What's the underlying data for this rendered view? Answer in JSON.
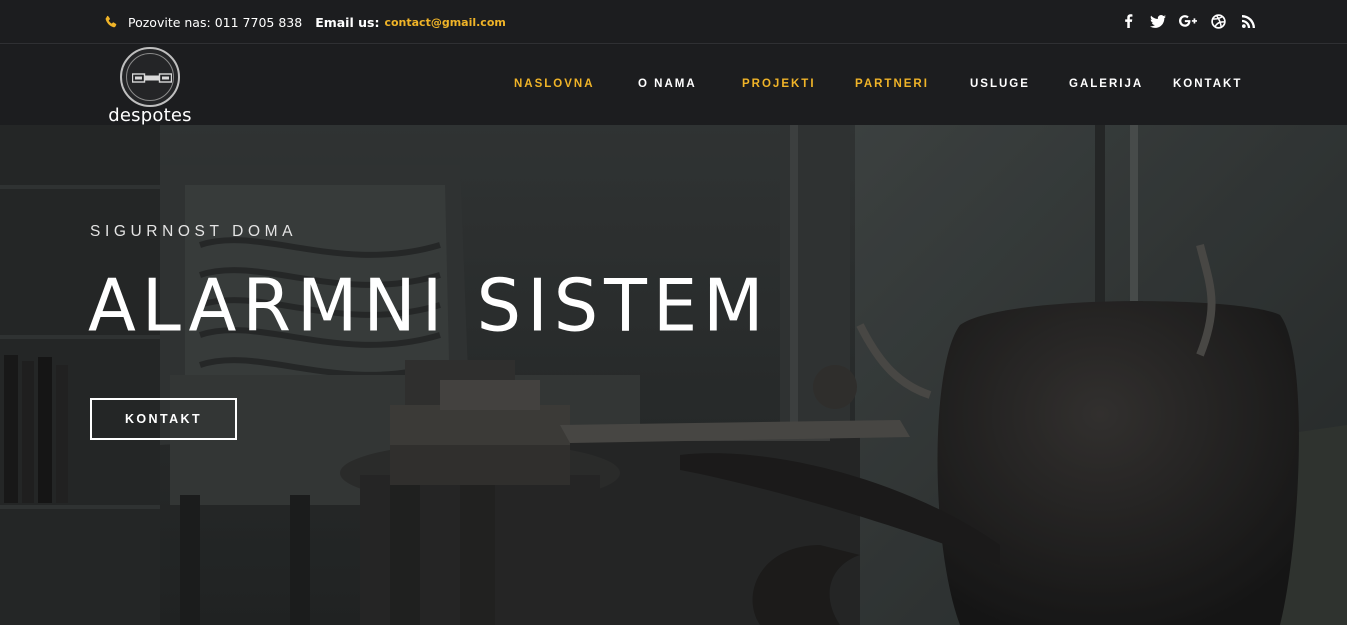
{
  "topbar": {
    "phone_label": "Pozovite nas:",
    "phone_number": "011 7705 838",
    "email_label": "Email us:",
    "email_value": "contact@gmail.com",
    "accent_color": "#f0b428",
    "socials": [
      "facebook-icon",
      "twitter-icon",
      "google-plus-icon",
      "dribbble-icon",
      "rss-icon"
    ]
  },
  "header": {
    "logo_text": "despotes",
    "nav": [
      {
        "label": "NASLOVNA",
        "active": true
      },
      {
        "label": "O NAMA",
        "active": false
      },
      {
        "label": "PROJEKTI",
        "active": true
      },
      {
        "label": "PARTNERI",
        "active": true
      },
      {
        "label": "USLUGE",
        "active": false
      },
      {
        "label": "GALERIJA",
        "active": false
      },
      {
        "label": "KONTAKT",
        "active": false
      }
    ]
  },
  "hero": {
    "eyebrow": "SIGURNOST DOMA",
    "title": "ALARMNI SISTEM",
    "cta_label": "KONTAKT"
  }
}
